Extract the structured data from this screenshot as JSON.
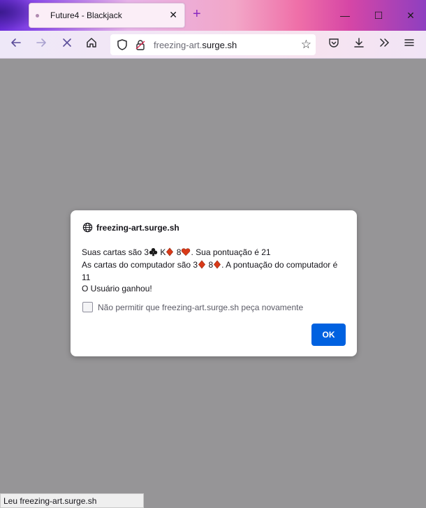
{
  "browser": {
    "tab_title": "Future4 - Blackjack",
    "tab_close": "✕",
    "new_tab": "+",
    "url_domain_prefix": "freezing-art.",
    "url_domain_main": "surge.sh",
    "window_controls": {
      "minimize": "—",
      "maximize": "☐",
      "close": "✕"
    },
    "icons": [
      "back-icon",
      "forward-icon",
      "stop-icon",
      "home-icon",
      "shield-icon",
      "lock-icon",
      "star-icon",
      "pocket-icon",
      "download-icon",
      "overflow-icon",
      "menu-icon"
    ]
  },
  "dialog": {
    "origin": "freezing-art.surge.sh",
    "line1": {
      "prefix": "Suas cartas são ",
      "cards": [
        {
          "rank": "3",
          "suit": "club"
        },
        {
          "rank": "K",
          "suit": "diamond"
        },
        {
          "rank": "8",
          "suit": "heart"
        }
      ],
      "suffix": ". Sua pontuação é 21"
    },
    "line2": {
      "prefix": "As cartas do computador são ",
      "cards": [
        {
          "rank": "3",
          "suit": "diamond"
        },
        {
          "rank": "8",
          "suit": "diamond"
        }
      ],
      "suffix": ". A pontuação do computador é"
    },
    "line3": "11",
    "line4": "O Usuário ganhou!",
    "checkbox_label": "Não permitir que freezing-art.surge.sh peça novamente",
    "checkbox_checked": false,
    "ok_label": "OK"
  },
  "status": {
    "text": "Leu freezing-art.surge.sh"
  },
  "colors": {
    "accent": "#0061e0",
    "suit_red": "#d93a18",
    "suit_black": "#1a1a1a",
    "overlay": "#969597"
  }
}
